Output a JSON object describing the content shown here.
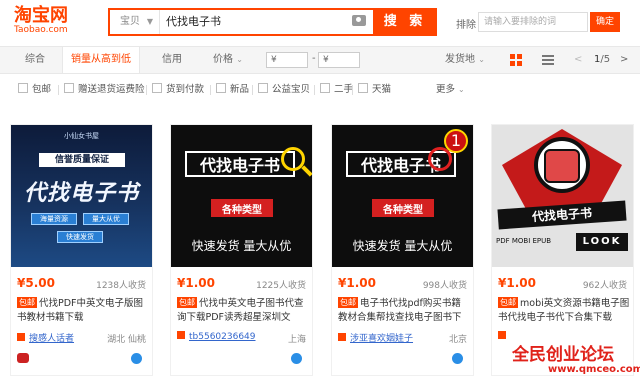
{
  "header": {
    "logo_cn": "淘宝网",
    "logo_en": "Taobao.com",
    "search": {
      "type_label": "宝贝",
      "query": "代找电子书",
      "button_label": "搜 索"
    },
    "exclude": {
      "label": "排除",
      "placeholder": "请输入要排除的词",
      "confirm_label": "确定"
    }
  },
  "sortbar": {
    "tabs": [
      "综合",
      "销量从高到低",
      "信用",
      "价格"
    ],
    "price_min_placeholder": "¥",
    "price_max_placeholder": "¥",
    "ship_from": "发货地",
    "page_current": "1",
    "page_total": "/5"
  },
  "filters": {
    "items": [
      "包邮",
      "赠送退货运费险",
      "货到付款",
      "新品",
      "公益宝贝",
      "二手",
      "天猫"
    ],
    "more": "更多"
  },
  "products": [
    {
      "price": "5.00",
      "buyers": "1238人收货",
      "title_tag": "包邮",
      "title": "代找PDF中英文电子版图书教材书籍下载",
      "shop": "搜感人话者",
      "location": "湖北 仙桃",
      "art": {
        "top": "小仙女书屋",
        "sub": "信誉质量保证",
        "main": "代找电子书",
        "btn1": "海量资源",
        "btn2": "量大从优",
        "btn3": "快速发货"
      }
    },
    {
      "price": "1.00",
      "buyers": "1225人收货",
      "title_tag": "包邮",
      "title": "代找中英文电子图书代查询下载PDF读秀超星深圳文",
      "shop": "tb5560236649",
      "location": "上海",
      "art": {
        "main": "代找电子书",
        "red": "各种类型",
        "bottom": "快速发货 量大从优"
      }
    },
    {
      "price": "1.00",
      "buyers": "998人收货",
      "title_tag": "包邮",
      "title": "电子书代找pdf购买书籍教材合集帮找查找电子图书下",
      "shop": "涉亚喜欢姻娃子",
      "location": "北京",
      "art": {
        "num": "1",
        "main": "代找电子书",
        "red": "各种类型",
        "bottom": "快速发货 量大从优"
      }
    },
    {
      "price": "1.00",
      "buyers": "962人收货",
      "title_tag": "包邮",
      "title": "mobi英文资源书籍电子图书代找电子书代下合集下载",
      "shop": "",
      "location": "",
      "art": {
        "main": "代找电子书",
        "formats": "PDF  MOBI  EPUB",
        "look": "LOOK"
      }
    }
  ],
  "watermark": {
    "text": "全民创业论坛",
    "url": "www.qmceo.com"
  },
  "colors": {
    "accent": "#ff4400",
    "link": "#3366cc"
  }
}
